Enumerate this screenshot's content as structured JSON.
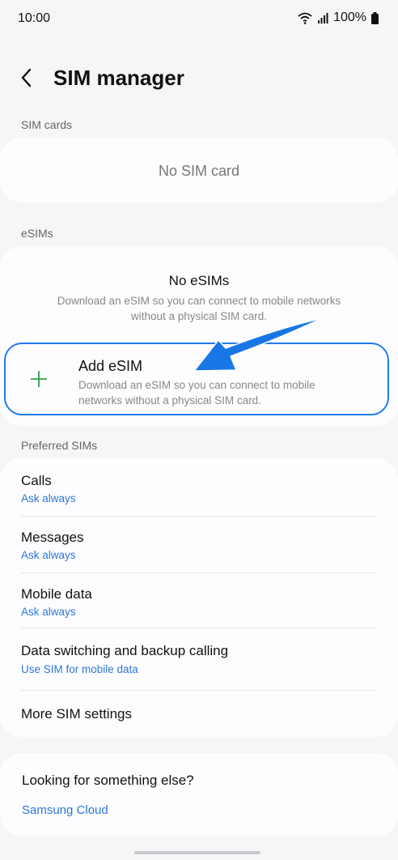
{
  "status_bar": {
    "time": "10:00",
    "battery": "100%"
  },
  "header": {
    "title": "SIM manager"
  },
  "sim_cards": {
    "label": "SIM cards",
    "empty_text": "No SIM card"
  },
  "esims": {
    "label": "eSIMs",
    "empty_title": "No eSIMs",
    "empty_desc": "Download an eSIM so you can connect to mobile networks without a physical SIM card.",
    "add_title": "Add eSIM",
    "add_desc": "Download an eSIM so you can connect to mobile networks without a physical SIM card."
  },
  "preferred": {
    "label": "Preferred SIMs",
    "items": [
      {
        "title": "Calls",
        "sub": "Ask always"
      },
      {
        "title": "Messages",
        "sub": "Ask always"
      },
      {
        "title": "Mobile data",
        "sub": "Ask always"
      },
      {
        "title": "Data switching and backup calling",
        "sub": "Use SIM for mobile data"
      },
      {
        "title": "More SIM settings"
      }
    ]
  },
  "help": {
    "title": "Looking for something else?",
    "link": "Samsung Cloud"
  },
  "colors": {
    "accent": "#1f7ae8",
    "link": "#2b77d6",
    "plus": "#2e9d4a"
  },
  "icons": [
    "back-arrow-icon",
    "wifi-icon",
    "signal-icon",
    "battery-icon",
    "plus-icon"
  ]
}
